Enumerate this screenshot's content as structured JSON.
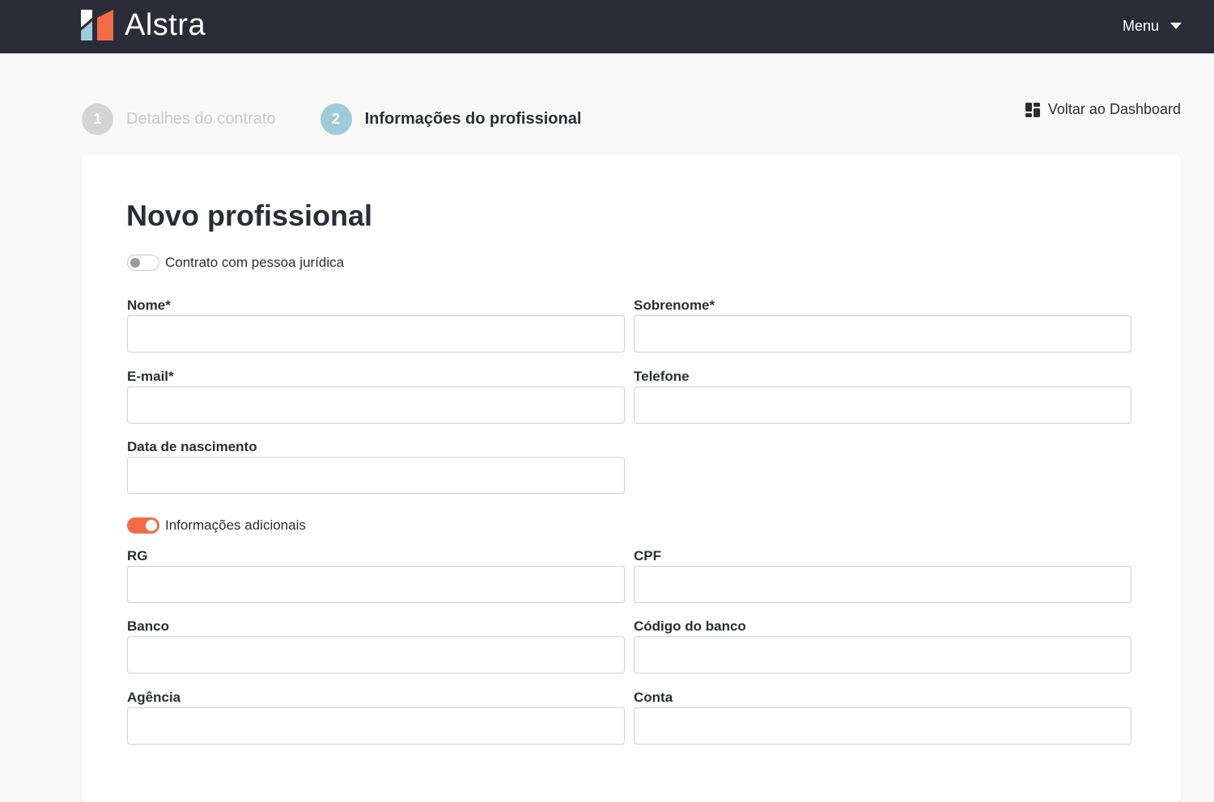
{
  "header": {
    "brand": "Alstra",
    "menu_label": "Menu",
    "colors": {
      "bar": "#2a2d38",
      "logo_blue": "#9fcbd8",
      "logo_orange": "#f36a45"
    }
  },
  "stepper": {
    "steps": [
      {
        "number": "1",
        "label": "Detalhes do contrato",
        "state": "inactive"
      },
      {
        "number": "2",
        "label": "Informações do profissional",
        "state": "active"
      }
    ]
  },
  "back_link": {
    "label": "Voltar ao Dashboard",
    "icon": "dashboard-icon"
  },
  "form": {
    "title": "Novo profissional",
    "toggle_pj": {
      "label": "Contrato com pessoa jurídica",
      "checked": false
    },
    "toggle_extra": {
      "label": "Informações adicionais",
      "checked": true
    },
    "fields": {
      "nome": {
        "label": "Nome*",
        "value": ""
      },
      "sobrenome": {
        "label": "Sobrenome*",
        "value": ""
      },
      "email": {
        "label": "E-mail*",
        "value": ""
      },
      "telefone": {
        "label": "Telefone",
        "value": ""
      },
      "nascimento": {
        "label": "Data de nascimento",
        "value": ""
      },
      "rg": {
        "label": "RG",
        "value": ""
      },
      "cpf": {
        "label": "CPF",
        "value": ""
      },
      "banco": {
        "label": "Banco",
        "value": ""
      },
      "codigo_banco": {
        "label": "Código do banco",
        "value": ""
      },
      "agencia": {
        "label": "Agência",
        "value": ""
      },
      "conta": {
        "label": "Conta",
        "value": ""
      }
    }
  },
  "accent_color": "#f36a45"
}
